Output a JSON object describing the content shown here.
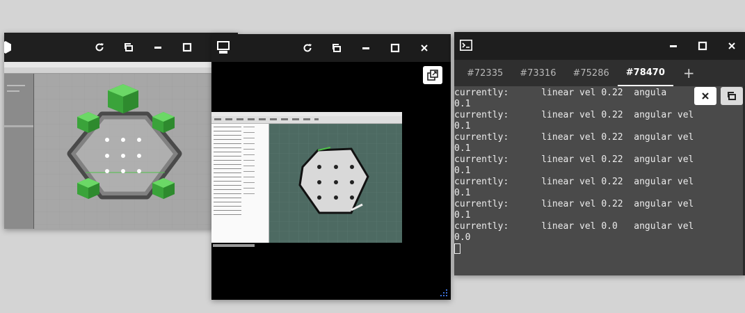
{
  "windows": {
    "gazebo": {
      "title_icon": "app-logo-icon",
      "controls": [
        "refresh-icon",
        "restore-icon",
        "minimize-icon",
        "maximize-icon"
      ]
    },
    "vnc": {
      "title_icon": "remote-desktop-icon",
      "controls": [
        "refresh-icon",
        "restore-icon",
        "minimize-icon",
        "maximize-icon",
        "close-icon"
      ],
      "expand_icon": "open-external-icon"
    },
    "terminal": {
      "title_icon": "terminal-icon",
      "tabs": [
        "#72335",
        "#73316",
        "#75286",
        "#78470"
      ],
      "active_tab": "#78470",
      "add_tab_label": "+",
      "lines": [
        "currently:      linear vel 0.22  angula",
        "0.1",
        "currently:      linear vel 0.22  angular vel",
        "0.1",
        "currently:      linear vel 0.22  angular vel",
        "0.1",
        "currently:      linear vel 0.22  angular vel",
        "0.1",
        "currently:      linear vel 0.22  angular vel",
        "0.1",
        "currently:      linear vel 0.22  angular vel",
        "0.1",
        "currently:      linear vel 0.0   angular vel",
        "0.0"
      ],
      "overlay_buttons": [
        "close-icon",
        "restore-icon"
      ]
    }
  },
  "colors": {
    "desktop": "#d4d4d4",
    "titlebar": "#1e1e1e",
    "terminal_bg": "#4a4a4a",
    "robot_green": "#4fc24a",
    "rviz_grid": "#4d6a62"
  }
}
